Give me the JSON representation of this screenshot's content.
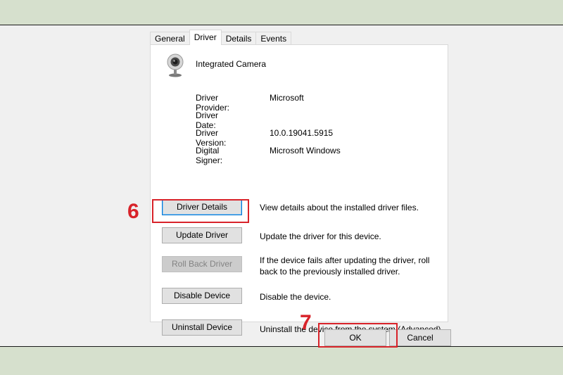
{
  "tabs": [
    {
      "label": "General"
    },
    {
      "label": "Driver",
      "active": true
    },
    {
      "label": "Details"
    },
    {
      "label": "Events"
    }
  ],
  "device": {
    "name": "Integrated Camera",
    "icon": "webcam-icon"
  },
  "properties": [
    {
      "label": "Driver Provider:",
      "value": "Microsoft"
    },
    {
      "label": "Driver Date:",
      "value": ""
    },
    {
      "label": "Driver Version:",
      "value": "10.0.19041.5915"
    },
    {
      "label": "Digital Signer:",
      "value": "Microsoft Windows"
    }
  ],
  "actions": [
    {
      "label": "Driver Details",
      "description": "View details about the installed driver files.",
      "enabled": true
    },
    {
      "label": "Update Driver",
      "description": "Update the driver for this device.",
      "enabled": true
    },
    {
      "label": "Roll Back Driver",
      "description": "If the device fails after updating the driver, roll back to the previously installed driver.",
      "enabled": false
    },
    {
      "label": "Disable Device",
      "description": "Disable the device.",
      "enabled": true
    },
    {
      "label": "Uninstall Device",
      "description": "Uninstall the device from the system (Advanced).",
      "enabled": true
    }
  ],
  "footer": {
    "ok_label": "OK",
    "cancel_label": "Cancel"
  },
  "annotations": {
    "step_update": "6",
    "step_ok": "7",
    "color": "#d8232a"
  }
}
